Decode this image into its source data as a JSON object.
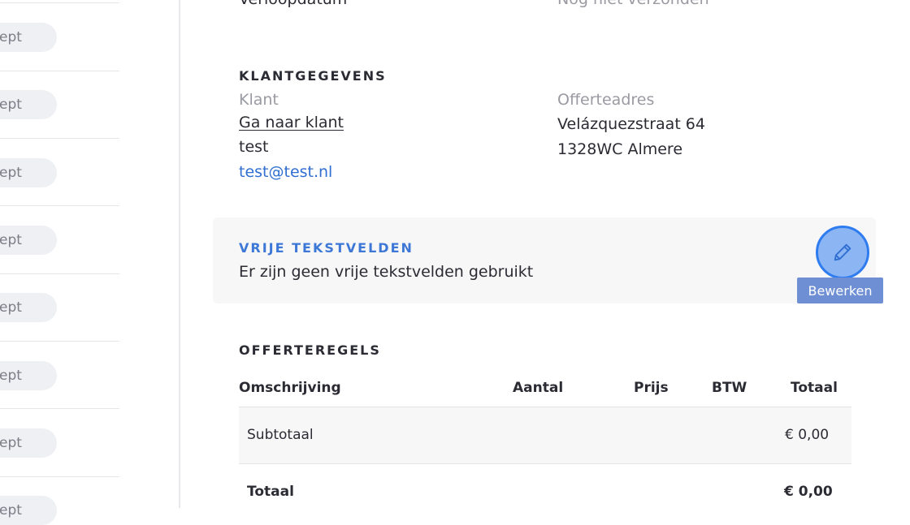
{
  "left_list": {
    "items": [
      {
        "label": "ept"
      },
      {
        "label": "ept"
      },
      {
        "label": "ept"
      },
      {
        "label": "ept"
      },
      {
        "label": "ept"
      },
      {
        "label": "ept"
      },
      {
        "label": "ept"
      },
      {
        "label": "ept"
      }
    ]
  },
  "top_row": {
    "label": "Verloopdatum",
    "value": "Nog niet verzonden"
  },
  "customer": {
    "section_title": "KLANTGEGEVENS",
    "client_label": "Klant",
    "goto_client": "Ga naar klant",
    "name": "test",
    "email": "test@test.nl",
    "address_label": "Offerteadres",
    "address_line1": "Velázquezstraat 64",
    "address_line2": "1328WC Almere"
  },
  "free_fields": {
    "title": "VRIJE TEKSTVELDEN",
    "text": "Er zijn geen vrije tekstvelden gebruikt",
    "edit_tooltip": "Bewerken"
  },
  "quote_lines": {
    "section_title": "OFFERTEREGELS",
    "columns": {
      "description": "Omschrijving",
      "quantity": "Aantal",
      "price": "Prijs",
      "vat": "BTW",
      "total": "Totaal"
    },
    "subtotal_label": "Subtotaal",
    "subtotal_value": "€ 0,00",
    "total_label": "Totaal",
    "total_value": "€ 0,00"
  },
  "colors": {
    "accent": "#3d78d6",
    "link": "#2f6fd1",
    "edit_button": "#8cb5f4",
    "tooltip": "#6e8fd3"
  }
}
